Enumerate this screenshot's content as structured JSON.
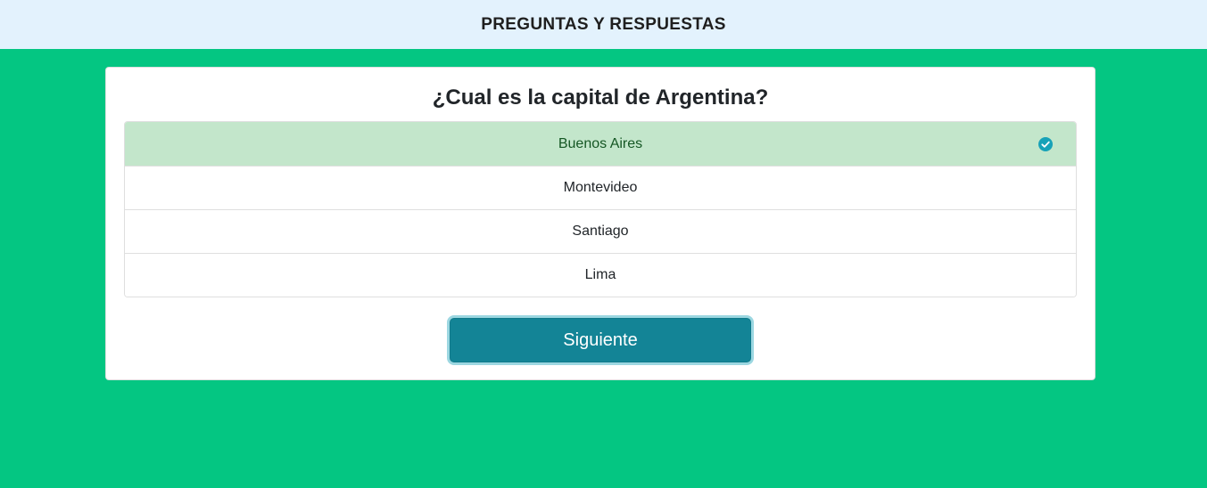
{
  "header": {
    "title": "PREGUNTAS Y RESPUESTAS"
  },
  "quiz": {
    "question": "¿Cual es la capital de Argentina?",
    "answers": [
      {
        "label": "Buenos Aires",
        "selected": true
      },
      {
        "label": "Montevideo",
        "selected": false
      },
      {
        "label": "Santiago",
        "selected": false
      },
      {
        "label": "Lima",
        "selected": false
      }
    ],
    "next_label": "Siguiente"
  },
  "icons": {
    "selected_marker": "check-circle-icon"
  },
  "colors": {
    "background": "#04c682",
    "header_bg": "#e3f2fd",
    "selected_bg": "#c3e6cb",
    "button_bg": "#138496",
    "check_icon": "#17a2b8"
  }
}
